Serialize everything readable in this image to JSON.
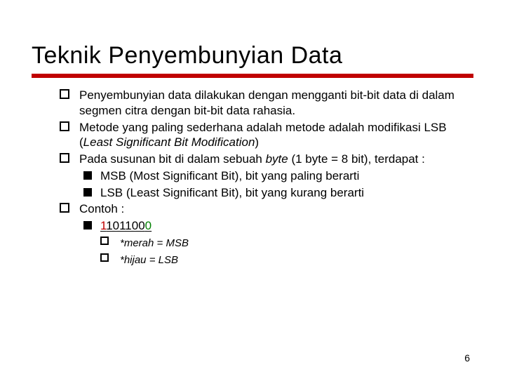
{
  "title": "Teknik Penyembunyian Data",
  "bullets": {
    "b1": "Penyembunyian data dilakukan dengan mengganti bit-bit data di dalam segmen citra dengan bit-bit data rahasia.",
    "b2_a": "Metode yang paling sederhana adalah metode adalah modifikasi LSB (",
    "b2_b": "Least Significant Bit Modification",
    "b2_c": ")",
    "b3_a": "Pada susunan bit di dalam sebuah ",
    "b3_b": "byte",
    "b3_c": "  (1 byte = 8 bit), terdapat :",
    "b3_s1": "MSB (Most Significant Bit), bit yang paling berarti",
    "b3_s2": "LSB (Least Significant Bit), bit yang kurang berarti",
    "b4": "Contoh :",
    "b4_s1_m": "1",
    "b4_s1_mid": "101100",
    "b4_s1_l": "0",
    "note1": "*merah = MSB",
    "note2": "*hijau = LSB"
  },
  "page": "6"
}
